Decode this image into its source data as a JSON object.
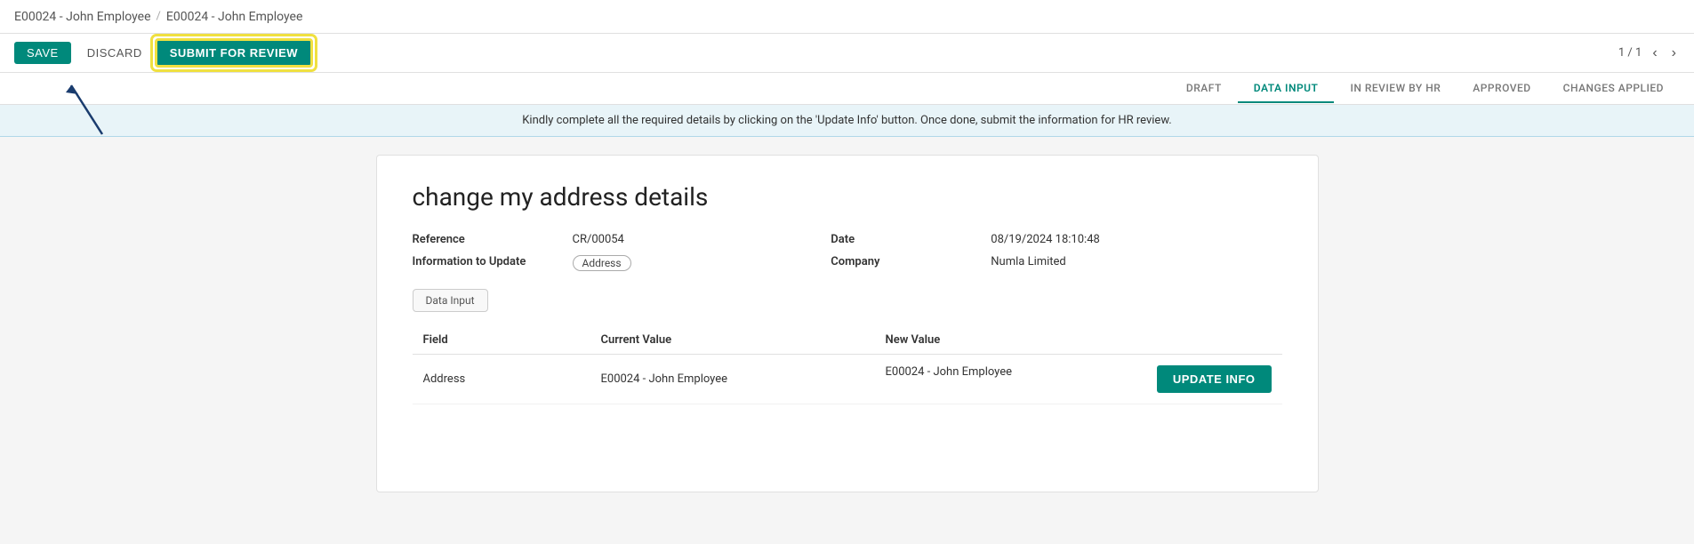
{
  "breadcrumb": {
    "part1": "E00024 - John Employee",
    "separator": "/",
    "part2": "E00024 - John Employee"
  },
  "toolbar": {
    "save_label": "SAVE",
    "discard_label": "DISCARD",
    "submit_review_label": "SUBMIT FOR REVIEW",
    "pagination": "1 / 1"
  },
  "status_steps": [
    {
      "label": "DRAFT",
      "active": false
    },
    {
      "label": "DATA INPUT",
      "active": true
    },
    {
      "label": "IN REVIEW BY HR",
      "active": false
    },
    {
      "label": "APPROVED",
      "active": false
    },
    {
      "label": "CHANGES APPLIED",
      "active": false
    }
  ],
  "info_banner": {
    "message": "Kindly complete all the required details by clicking on the 'Update Info' button. Once done, submit the information for HR review."
  },
  "form": {
    "title": "change my address details",
    "fields": {
      "reference_label": "Reference",
      "reference_value": "CR/00054",
      "date_label": "Date",
      "date_value": "08/19/2024 18:10:48",
      "info_to_update_label": "Information to Update",
      "info_to_update_value": "Address",
      "company_label": "Company",
      "company_value": "Numla Limited"
    },
    "tab_label": "Data Input",
    "table": {
      "col_field": "Field",
      "col_current": "Current Value",
      "col_new": "New Value",
      "rows": [
        {
          "field": "Address",
          "current_value": "E00024 - John Employee",
          "new_value": "E00024 - John Employee"
        }
      ]
    },
    "update_info_btn": "UPDATE INFO"
  }
}
